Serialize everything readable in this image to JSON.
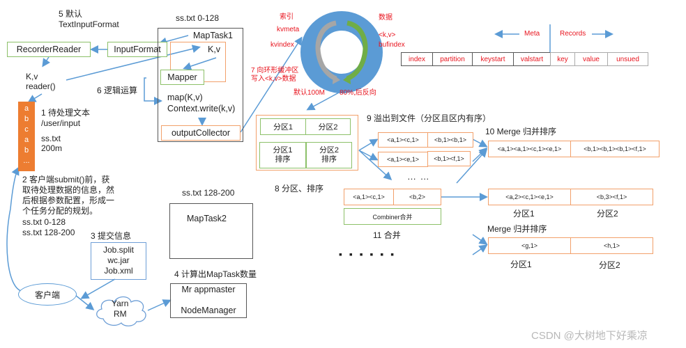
{
  "labels": {
    "step5": "5 默认",
    "step5_sub": "TextInputFormat",
    "maptask1_split": "ss.txt 0-128",
    "kv_reader_1": "K,v",
    "kv_reader_2": "reader()",
    "step6": "6 逻辑运算",
    "step1_title": "1 待处理文本",
    "step1_path": "/user/input",
    "step1_file": "ss.txt",
    "step1_size": "200m",
    "step2_line1": "2 客户端submit()前，获",
    "step2_line2": "取待处理数据的信息，然",
    "step2_line3": "后根据参数配置，形成一",
    "step2_line4": "个任务分配的规划。",
    "step2_split1": "ss.txt  0-128",
    "step2_split2": "ss.txt  128-200",
    "step3": "3 提交信息",
    "step4": "4 计算出MapTask数量",
    "maptask2_split": "ss.txt 128-200",
    "step8": "8 分区、排序",
    "step9": "9 溢出到文件（分区且区内有序）",
    "step10": "10 Merge 归并排序",
    "step11": "11 合并",
    "merge2": "Merge 归并排序",
    "dots_mid": "…  …",
    "dots_bottom": "▪ ▪ ▪   ▪ ▪ ▪",
    "partition1_a": "分区1",
    "partition2_a": "分区2",
    "partition1_b": "分区1",
    "partition2_b": "分区2",
    "watermark": "CSDN @大树地下好乘凉"
  },
  "ring": {
    "index_title": "索引",
    "kvmeta": "kvmeta",
    "kvindex": "kvindex",
    "data_title": "数据",
    "kv": "<k,v>",
    "bufindex": "bufindex",
    "step7_line1": "7 向环形缓冲区",
    "step7_line2": "写入<k,v>数据",
    "default_size": "默认100M",
    "reverse": "80%,后反向",
    "colors": {
      "ring": "#5b9bd5",
      "meta_arrow": "#a6a6a6",
      "data_arrow": "#70ad47"
    }
  },
  "buffer_table": {
    "meta_label": "Meta",
    "records_label": "Records",
    "cells": [
      "index",
      "partition",
      "keystart",
      "valstart",
      "key",
      "value",
      "unsued"
    ]
  },
  "boxes": {
    "recorder_reader": "RecorderReader",
    "input_format": "InputFormat",
    "maptask1": "MapTask1",
    "kv": "K,v",
    "mapper": "Mapper",
    "map_call": "map(K,v)",
    "context_write": "Context.write(k,v)",
    "output_collector": "outputCollector",
    "maptask2": "MapTask2",
    "job_split": "Job.split",
    "wc_jar": "wc.jar",
    "job_xml": "Job.xml",
    "client": "客户端",
    "yarn": "Yarn",
    "rm": "RM",
    "mr_appmaster": "Mr appmaster",
    "node_manager": "NodeManager",
    "combiner": "Combiner合并"
  },
  "input_block": {
    "chars": [
      "a",
      "b",
      "c",
      "a",
      "b",
      "..."
    ],
    "color": "#ed7d31"
  },
  "sort_area": {
    "p1": "分区1",
    "p2": "分区2",
    "p1_sort_1": "分区1",
    "p1_sort_2": "排序",
    "p2_sort_1": "分区2",
    "p2_sort_2": "排序"
  },
  "spill_files": [
    [
      "<a,1><c,1>",
      "<b,1><b,1>"
    ],
    [
      "<a,1><e,1>",
      "<b,1><f,1>"
    ]
  ],
  "merged": [
    "<a,1><a,1><c,1><e,1>",
    "<b,1><b,1><b,1><f,1>"
  ],
  "combined_input": [
    "<a,1><c,1>",
    "<b,2>"
  ],
  "combined_output": [
    "<a,2><c,1><e,1>",
    "<b,3><f,1>"
  ],
  "final_merge": [
    "<g,1>",
    "<h,1>"
  ],
  "colors": {
    "arrow": "#5b9bd5",
    "green_border": "#8cc068",
    "orange_border": "#f2a06a",
    "red_text": "#e8141e"
  }
}
